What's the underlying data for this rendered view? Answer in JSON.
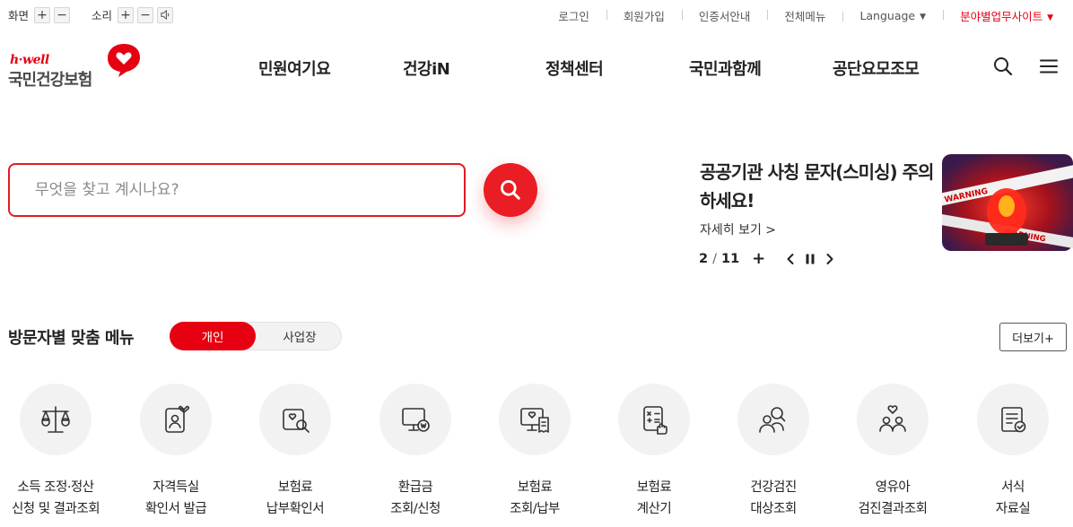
{
  "utility": {
    "screen_label": "화면",
    "sound_label": "소리",
    "plus": "+",
    "minus": "−",
    "links": [
      "로그인",
      "회원가입",
      "인증서안내",
      "전체메뉴"
    ],
    "language_label": "Language",
    "business_site_label": "분야별업무사이트"
  },
  "logo": {
    "hwell": "h·well",
    "name": "국민건강보험"
  },
  "nav": [
    "민원여기요",
    "건강iN",
    "정책센터",
    "국민과함께",
    "공단요모조모"
  ],
  "search": {
    "placeholder": "무엇을 찾고 계시나요?",
    "value": ""
  },
  "banner": {
    "title": "공공기관 사칭 문자(스미싱) 주의하세요!",
    "more_label": "자세히 보기 >",
    "image_text": "WARNING",
    "current_page": "2",
    "page_separator": "/",
    "total_pages": "11",
    "plus_label": "+"
  },
  "menu_section": {
    "title": "방문자별 맞춤 메뉴",
    "tab_personal": "개인",
    "tab_business": "사업장",
    "more_label": "더보기+"
  },
  "services": [
    {
      "line1": "소득 조정·정산",
      "line2": "신청 및 결과조회",
      "icon": "scale-icon"
    },
    {
      "line1": "자격득실",
      "line2": "확인서 발급",
      "icon": "id-card-heart-icon"
    },
    {
      "line1": "보험료",
      "line2": "납부확인서",
      "icon": "document-search-icon"
    },
    {
      "line1": "환급금",
      "line2": "조회/신청",
      "icon": "monitor-coin-icon"
    },
    {
      "line1": "보험료",
      "line2": "조회/납부",
      "icon": "monitor-receipt-icon"
    },
    {
      "line1": "보험료",
      "line2": "계산기",
      "icon": "calculator-icon"
    },
    {
      "line1": "건강검진",
      "line2": "대상조회",
      "icon": "people-search-icon"
    },
    {
      "line1": "영유아",
      "line2": "검진결과조회",
      "icon": "family-heart-icon"
    },
    {
      "line1": "서식",
      "line2": "자료실",
      "icon": "form-check-icon"
    }
  ],
  "colors": {
    "accent": "#e60012",
    "text": "#222222",
    "icon_bg": "#f2f2f2"
  }
}
